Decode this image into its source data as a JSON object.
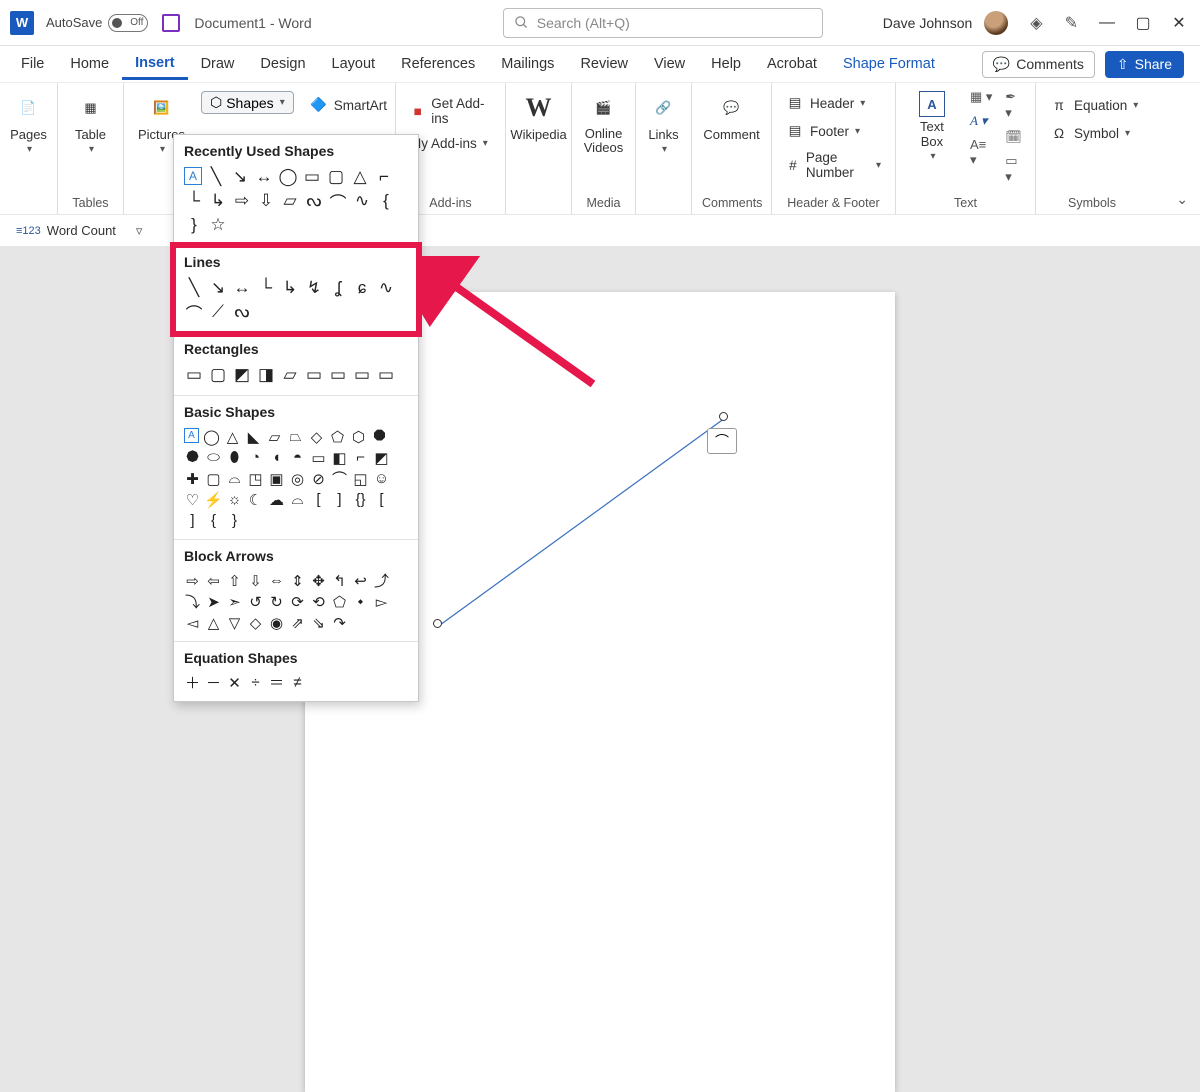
{
  "title": {
    "autosave": "AutoSave",
    "autosave_state": "Off",
    "doc": "Document1  -  Word"
  },
  "search": {
    "placeholder": "Search (Alt+Q)"
  },
  "user": {
    "name": "Dave Johnson"
  },
  "menu": {
    "file": "File",
    "home": "Home",
    "insert": "Insert",
    "draw": "Draw",
    "design": "Design",
    "layout": "Layout",
    "references": "References",
    "mailings": "Mailings",
    "review": "Review",
    "view": "View",
    "help": "Help",
    "acrobat": "Acrobat",
    "shapeformat": "Shape Format",
    "comments": "Comments",
    "share": "Share"
  },
  "ribbon": {
    "pages": "Pages",
    "table": "Table",
    "pictures": "Pictures",
    "tables_group": "Tables",
    "shapes": "Shapes",
    "smartart": "SmartArt",
    "getaddins": "Get Add-ins",
    "myaddins": "My Add-ins",
    "addins_group": "Add-ins",
    "wikipedia": "Wikipedia",
    "onlinevideos": "Online Videos",
    "media_group": "Media",
    "links": "Links",
    "comment": "Comment",
    "comments_group": "Comments",
    "header": "Header",
    "footer": "Footer",
    "pagenum": "Page Number",
    "hf_group": "Header & Footer",
    "textbox": "Text Box",
    "text_group": "Text",
    "equation": "Equation",
    "symbol": "Symbol",
    "symbols_group": "Symbols"
  },
  "quick": {
    "wordcount": "Word Count"
  },
  "shapes_dd": {
    "recent": "Recently Used Shapes",
    "lines": "Lines",
    "rectangles": "Rectangles",
    "basic": "Basic Shapes",
    "block": "Block Arrows",
    "equation": "Equation Shapes"
  }
}
